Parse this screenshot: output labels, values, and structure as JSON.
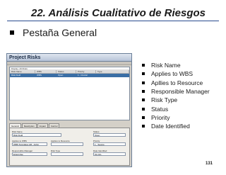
{
  "slide": {
    "title": "22. Análisis Cualitativo de Riesgos",
    "main_bullet": "Pestaña General",
    "page_number": "131"
  },
  "screenshot": {
    "window_title": "Project Risks",
    "grid_caption": "Display: All Risks",
    "columns": [
      "Risk Name",
      "WBS",
      "Status",
      "Priority",
      "Type"
    ],
    "selected_row": [
      "Risk Field",
      "WBS",
      "Open",
      "1 - Crucial",
      ""
    ],
    "tabs": [
      "General",
      "Description",
      "Impact",
      "Control"
    ],
    "form": {
      "risk_name_label": "Risk Name",
      "risk_name_value": "Risk Field",
      "status_label": "Status",
      "status_value": "Open",
      "applies_wbs_label": "Applies to WBS",
      "applies_wbs_value": "WBS Templates AR - Activi",
      "applies_resource_label": "Applies to Resource",
      "priority_label": "Priority",
      "priority_value": "1 - Severe",
      "responsible_label": "Responsible Manager",
      "responsible_value": "Enterprise",
      "risk_type_label": "Risk Type",
      "date_label": "Date Identified",
      "date_value": "01-Oct-"
    }
  },
  "fields": [
    "Risk Name",
    "Applies to WBS",
    "Apllies to Resource",
    "Responsible Manager",
    "Risk Type",
    "Status",
    "Priority",
    "Date Identified"
  ]
}
